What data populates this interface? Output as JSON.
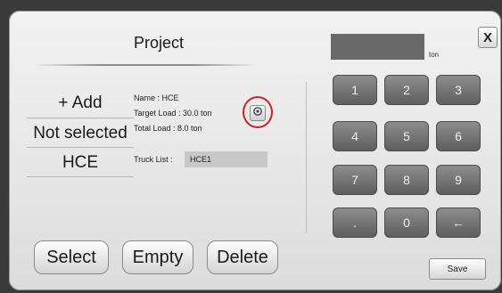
{
  "dialog": {
    "title": "Project",
    "close_label": "X"
  },
  "project_list": [
    {
      "label": "+ Add"
    },
    {
      "label": "Not selected"
    },
    {
      "label": "HCE"
    }
  ],
  "details": {
    "name": "Name : HCE",
    "target_load": "Target Load : 30.0 ton",
    "total_load": "Total Load : 8.0 ton",
    "truck_list_label": "Truck List :",
    "truck_list_value": "HCE1"
  },
  "actions": {
    "select": "Select",
    "empty": "Empty",
    "delete": "Delete"
  },
  "keypad": {
    "display_value": "",
    "unit": "ton",
    "keys": [
      "1",
      "2",
      "3",
      "4",
      "5",
      "6",
      "7",
      "8",
      "9",
      ".",
      "0",
      "←"
    ],
    "save_label": "Save"
  },
  "icons": {
    "settings": "gear-icon"
  },
  "colors": {
    "highlight": "#d0202a",
    "keypad_key": "#6e6e6e",
    "display_field": "#6a6a6a"
  }
}
